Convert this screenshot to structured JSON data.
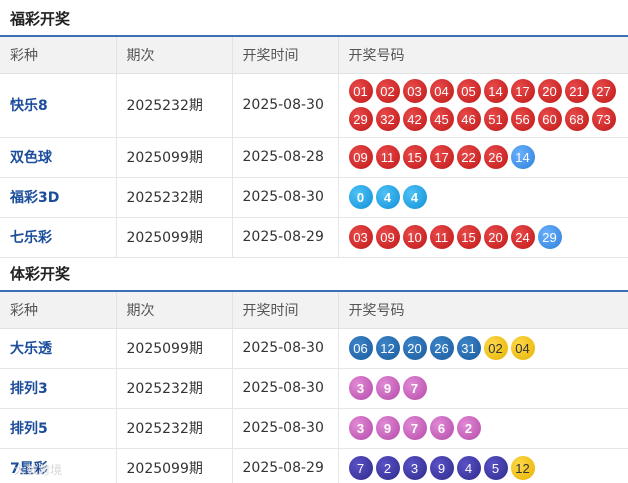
{
  "welfare": {
    "title": "福彩开奖",
    "headers": [
      "彩种",
      "期次",
      "开奖时间",
      "开奖号码"
    ],
    "rows": [
      {
        "name": "快乐8",
        "issue": "2025232期",
        "date": "2025-08-30",
        "balls": [
          {
            "n": "01",
            "c": "red"
          },
          {
            "n": "02",
            "c": "red"
          },
          {
            "n": "03",
            "c": "red"
          },
          {
            "n": "04",
            "c": "red"
          },
          {
            "n": "05",
            "c": "red"
          },
          {
            "n": "14",
            "c": "red"
          },
          {
            "n": "17",
            "c": "red"
          },
          {
            "n": "20",
            "c": "red"
          },
          {
            "n": "21",
            "c": "red"
          },
          {
            "n": "27",
            "c": "red"
          },
          {
            "n": "29",
            "c": "red"
          },
          {
            "n": "32",
            "c": "red"
          },
          {
            "n": "42",
            "c": "red"
          },
          {
            "n": "45",
            "c": "red"
          },
          {
            "n": "46",
            "c": "red"
          },
          {
            "n": "51",
            "c": "red"
          },
          {
            "n": "56",
            "c": "red"
          },
          {
            "n": "60",
            "c": "red"
          },
          {
            "n": "68",
            "c": "red"
          },
          {
            "n": "73",
            "c": "red"
          }
        ]
      },
      {
        "name": "双色球",
        "issue": "2025099期",
        "date": "2025-08-28",
        "balls": [
          {
            "n": "09",
            "c": "red"
          },
          {
            "n": "11",
            "c": "red"
          },
          {
            "n": "15",
            "c": "red"
          },
          {
            "n": "17",
            "c": "red"
          },
          {
            "n": "22",
            "c": "red"
          },
          {
            "n": "26",
            "c": "red"
          },
          {
            "n": "14",
            "c": "blue"
          }
        ]
      },
      {
        "name": "福彩3D",
        "issue": "2025232期",
        "date": "2025-08-30",
        "balls": [
          {
            "n": "0",
            "c": "sky"
          },
          {
            "n": "4",
            "c": "sky"
          },
          {
            "n": "4",
            "c": "sky"
          }
        ]
      },
      {
        "name": "七乐彩",
        "issue": "2025099期",
        "date": "2025-08-29",
        "balls": [
          {
            "n": "03",
            "c": "red"
          },
          {
            "n": "09",
            "c": "red"
          },
          {
            "n": "10",
            "c": "red"
          },
          {
            "n": "11",
            "c": "red"
          },
          {
            "n": "15",
            "c": "red"
          },
          {
            "n": "20",
            "c": "red"
          },
          {
            "n": "24",
            "c": "red"
          },
          {
            "n": "29",
            "c": "blue"
          }
        ]
      }
    ]
  },
  "sports": {
    "title": "体彩开奖",
    "headers": [
      "彩种",
      "期次",
      "开奖时间",
      "开奖号码"
    ],
    "rows": [
      {
        "name": "大乐透",
        "issue": "2025099期",
        "date": "2025-08-30",
        "balls": [
          {
            "n": "06",
            "c": "navy"
          },
          {
            "n": "12",
            "c": "navy"
          },
          {
            "n": "20",
            "c": "navy"
          },
          {
            "n": "26",
            "c": "navy"
          },
          {
            "n": "31",
            "c": "navy"
          },
          {
            "n": "02",
            "c": "gold"
          },
          {
            "n": "04",
            "c": "gold"
          }
        ]
      },
      {
        "name": "排列3",
        "issue": "2025232期",
        "date": "2025-08-30",
        "balls": [
          {
            "n": "3",
            "c": "pink"
          },
          {
            "n": "9",
            "c": "pink"
          },
          {
            "n": "7",
            "c": "pink"
          }
        ]
      },
      {
        "name": "排列5",
        "issue": "2025232期",
        "date": "2025-08-30",
        "balls": [
          {
            "n": "3",
            "c": "pink"
          },
          {
            "n": "9",
            "c": "pink"
          },
          {
            "n": "7",
            "c": "pink"
          },
          {
            "n": "6",
            "c": "pink"
          },
          {
            "n": "2",
            "c": "pink"
          }
        ]
      },
      {
        "name": "7星彩",
        "issue": "2025099期",
        "date": "2025-08-29",
        "balls": [
          {
            "n": "7",
            "c": "violet"
          },
          {
            "n": "2",
            "c": "violet"
          },
          {
            "n": "3",
            "c": "violet"
          },
          {
            "n": "9",
            "c": "violet"
          },
          {
            "n": "4",
            "c": "violet"
          },
          {
            "n": "5",
            "c": "violet"
          },
          {
            "n": "12",
            "c": "gold"
          }
        ]
      }
    ]
  },
  "watermark": "大数跨境"
}
